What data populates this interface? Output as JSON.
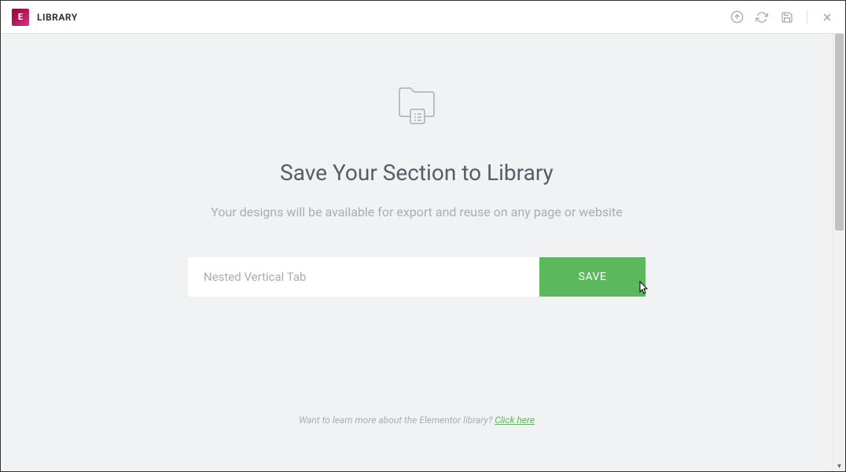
{
  "titlebar": {
    "logo_letter": "E",
    "title": "LIBRARY"
  },
  "content": {
    "heading": "Save Your Section to Library",
    "subtext": "Your designs will be available for export and reuse on any page or website",
    "input_value": "Nested Vertical Tab",
    "save_label": "SAVE",
    "footer_prompt": "Want to learn more about the Elementor library? ",
    "footer_link": "Click here"
  }
}
